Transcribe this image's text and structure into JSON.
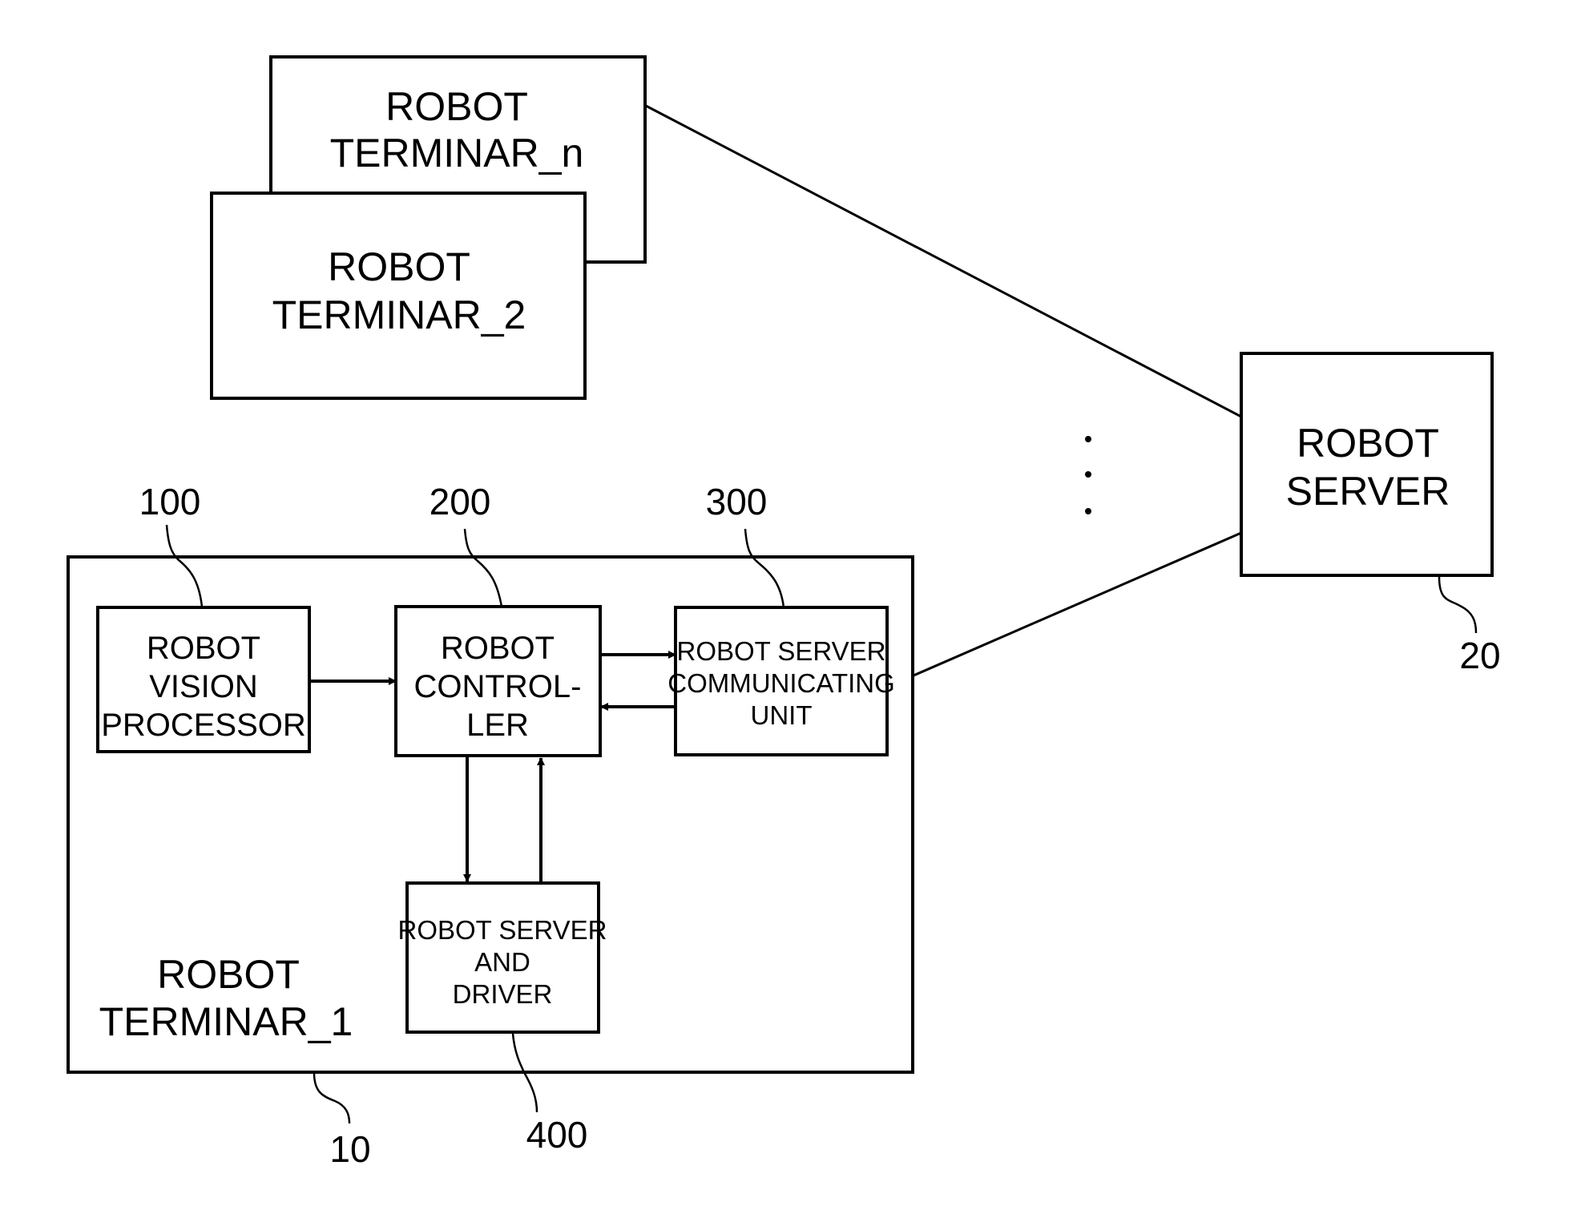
{
  "diagram": {
    "terminal_n": {
      "line1": "ROBOT",
      "line2": "TERMINAR_n"
    },
    "terminal_2": {
      "line1": "ROBOT",
      "line2": "TERMINAR_2"
    },
    "terminal_1": {
      "line1": "ROBOT",
      "line2": "TERMINAR_1",
      "ref": "10"
    },
    "server": {
      "line1": "ROBOT",
      "line2": "SERVER",
      "ref": "20"
    },
    "vision_processor": {
      "line1": "ROBOT",
      "line2": "VISION",
      "line3": "PROCESSOR",
      "ref": "100"
    },
    "controller": {
      "line1": "ROBOT",
      "line2": "CONTROL-",
      "line3": "LER",
      "ref": "200"
    },
    "communicating_unit": {
      "line1": "ROBOT SERVER",
      "line2": "COMMUNICATING",
      "line3": "UNIT",
      "ref": "300"
    },
    "driver": {
      "line1": "ROBOT SERVER",
      "line2": "AND",
      "line3": "DRIVER",
      "ref": "400"
    },
    "ellipsis_dots": 3
  }
}
